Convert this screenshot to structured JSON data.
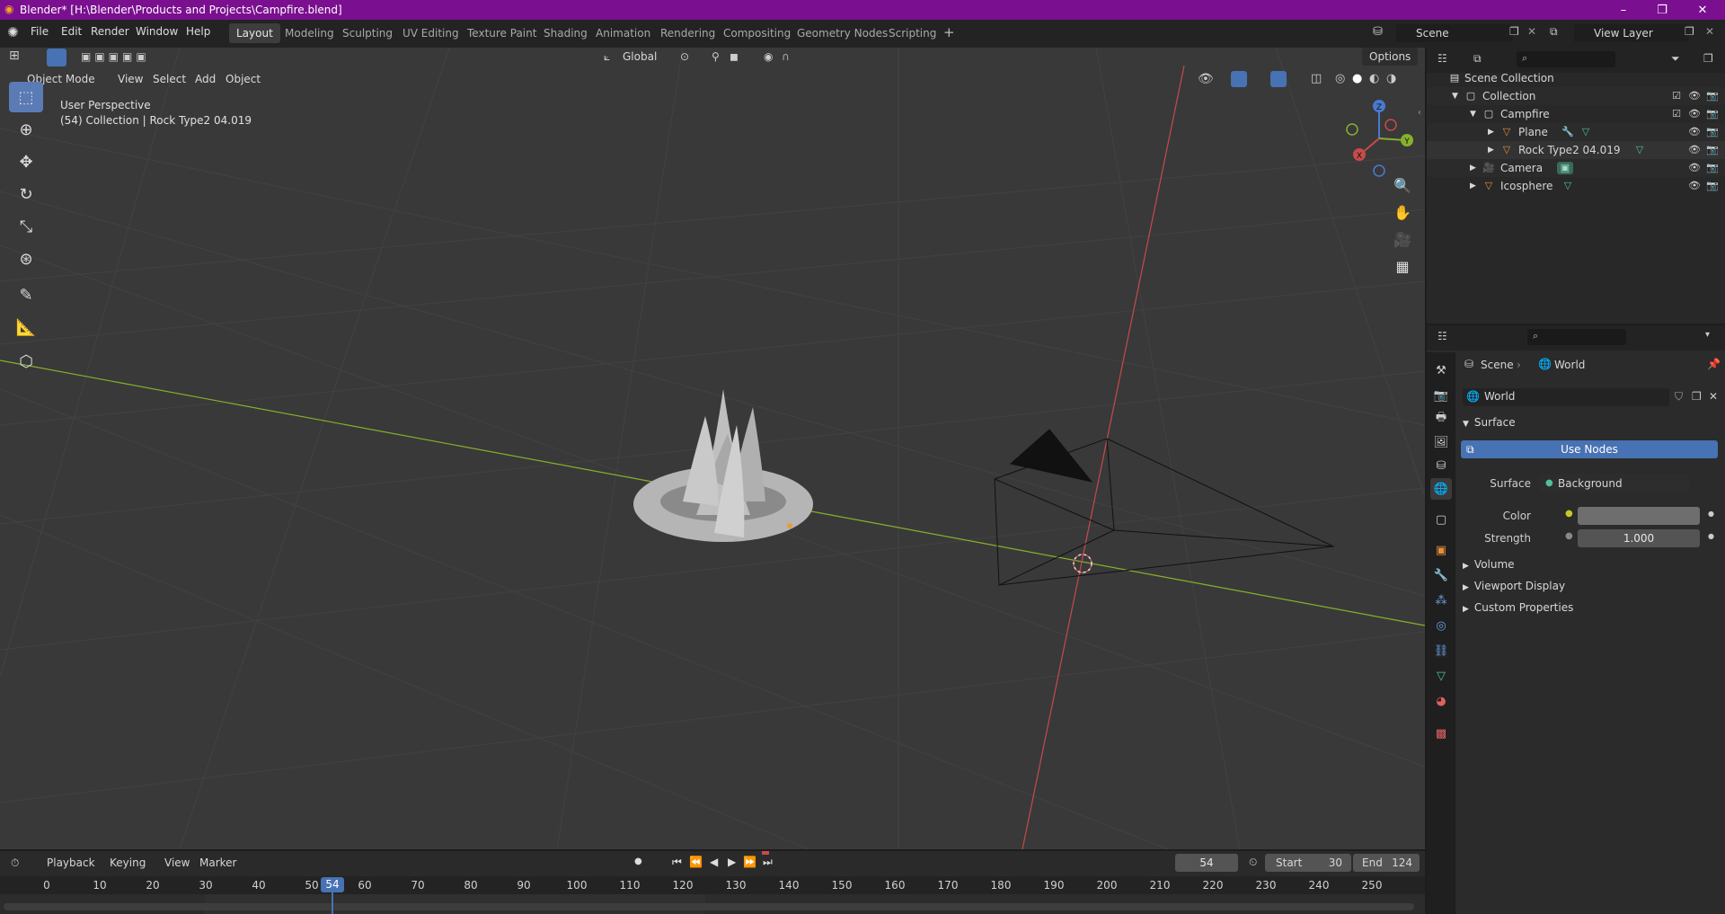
{
  "window": {
    "title": "Blender* [H:\\Blender\\Products and Projects\\Campfire.blend]",
    "minimize_glyph": "–",
    "maximize_glyph": "❐",
    "close_glyph": "✕"
  },
  "menu": [
    "File",
    "Edit",
    "Render",
    "Window",
    "Help"
  ],
  "workspaces": [
    "Layout",
    "Modeling",
    "Sculpting",
    "UV Editing",
    "Texture Paint",
    "Shading",
    "Animation",
    "Rendering",
    "Compositing",
    "Geometry Nodes",
    "Scripting"
  ],
  "active_workspace": "Layout",
  "scene": {
    "name": "Scene",
    "view_layer": "View Layer"
  },
  "viewport": {
    "mode": "Object Mode",
    "header_menus": [
      "View",
      "Select",
      "Add",
      "Object"
    ],
    "transform_orientation": "Global",
    "options_label": "Options",
    "overlay_line1": "User Perspective",
    "overlay_line2": "(54) Collection | Rock Type2 04.019",
    "gizmo_labels": {
      "x": "X",
      "y": "Y",
      "z": "Z"
    },
    "colors": {
      "background": "#393939",
      "x_axis": "#c64b4b",
      "y_axis": "#86b12c",
      "grid": "#444444"
    }
  },
  "outliner": {
    "rows": [
      {
        "label": "Scene Collection"
      },
      {
        "label": "Collection"
      },
      {
        "label": "Campfire"
      },
      {
        "label": "Plane"
      },
      {
        "label": "Rock Type2 04.019"
      },
      {
        "label": "Camera"
      },
      {
        "label": "Icosphere"
      }
    ]
  },
  "properties": {
    "breadcrumb": [
      "Scene",
      "World"
    ],
    "world_name": "World",
    "panels": {
      "surface": "Surface",
      "volume": "Volume",
      "viewport_display": "Viewport Display",
      "custom_properties": "Custom Properties"
    },
    "use_nodes_label": "Use Nodes",
    "surface_label": "Surface",
    "surface_value": "Background",
    "color_label": "Color",
    "color_value_hex": "#6e6e6e",
    "strength_label": "Strength",
    "strength_value": "1.000",
    "accent": "#4772b3"
  },
  "timeline": {
    "menus": [
      "Playback",
      "Keying",
      "View",
      "Marker"
    ],
    "current_frame": "54",
    "start_label": "Start",
    "start_value": "30",
    "end_label": "End",
    "end_value": "124",
    "ticks": [
      "0",
      "10",
      "20",
      "30",
      "40",
      "50",
      "60",
      "70",
      "80",
      "90",
      "100",
      "110",
      "120",
      "130",
      "140",
      "150",
      "160",
      "170",
      "180",
      "190",
      "200",
      "210",
      "220",
      "230",
      "240",
      "250"
    ],
    "playhead_label": "54"
  }
}
